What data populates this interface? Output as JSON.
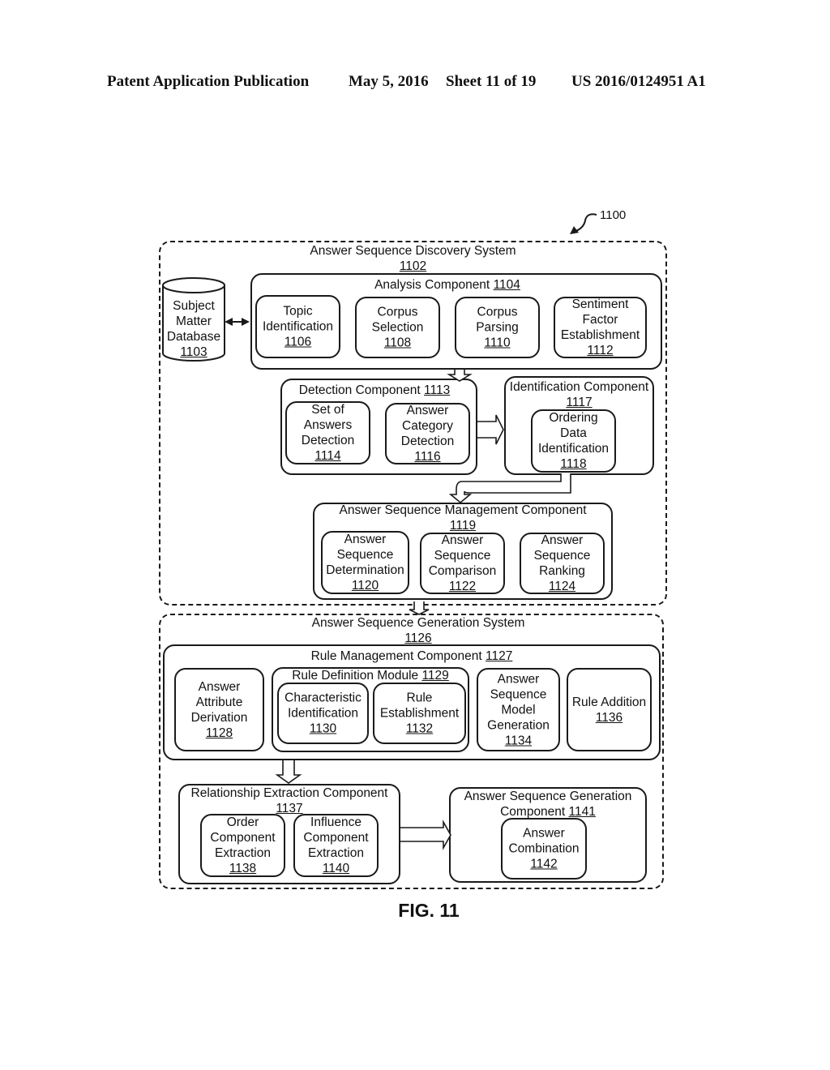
{
  "header": {
    "publication": "Patent Application Publication",
    "date": "May 5, 2016",
    "sheet": "Sheet 11 of 19",
    "patent_number": "US 2016/0124951 A1"
  },
  "figure": {
    "ref": "1100",
    "caption": "FIG. 11"
  },
  "discovery_system": {
    "title": "Answer Sequence Discovery System",
    "num": "1102",
    "database": {
      "lines": [
        "Subject",
        "Matter",
        "Database"
      ],
      "num": "1103"
    },
    "analysis": {
      "title": "Analysis Component",
      "num": "1104",
      "items": [
        {
          "lines": [
            "Topic",
            "Identification"
          ],
          "num": "1106"
        },
        {
          "lines": [
            "Corpus",
            "Selection"
          ],
          "num": "1108"
        },
        {
          "lines": [
            "Corpus",
            "Parsing"
          ],
          "num": "1110"
        },
        {
          "lines": [
            "Sentiment",
            "Factor",
            "Establishment"
          ],
          "num": "1112"
        }
      ]
    },
    "detection": {
      "title": "Detection Component",
      "num": "1113",
      "items": [
        {
          "lines": [
            "Set of",
            "Answers",
            "Detection"
          ],
          "num": "1114"
        },
        {
          "lines": [
            "Answer",
            "Category",
            "Detection"
          ],
          "num": "1116"
        }
      ]
    },
    "identification": {
      "title": "Identification Component",
      "num": "1117",
      "items": [
        {
          "lines": [
            "Ordering",
            "Data",
            "Identification"
          ],
          "num": "1118"
        }
      ]
    },
    "management": {
      "title": "Answer Sequence Management Component",
      "num": "1119",
      "items": [
        {
          "lines": [
            "Answer",
            "Sequence",
            "Determination"
          ],
          "num": "1120"
        },
        {
          "lines": [
            "Answer",
            "Sequence",
            "Comparison"
          ],
          "num": "1122"
        },
        {
          "lines": [
            "Answer",
            "Sequence",
            "Ranking"
          ],
          "num": "1124"
        }
      ]
    }
  },
  "generation_system": {
    "title": "Answer Sequence Generation System",
    "num": "1126",
    "rule_management": {
      "title": "Rule Management Component",
      "num": "1127",
      "attribute": {
        "lines": [
          "Answer",
          "Attribute",
          "Derivation"
        ],
        "num": "1128"
      },
      "rule_definition": {
        "title": "Rule Definition Module",
        "num": "1129",
        "items": [
          {
            "lines": [
              "Characteristic",
              "Identification"
            ],
            "num": "1130"
          },
          {
            "lines": [
              "Rule",
              "Establishment"
            ],
            "num": "1132"
          }
        ]
      },
      "model_generation": {
        "lines": [
          "Answer",
          "Sequence",
          "Model",
          "Generation"
        ],
        "num": "1134"
      },
      "rule_addition": {
        "lines": [
          "Rule Addition"
        ],
        "num": "1136"
      }
    },
    "relationship": {
      "title": "Relationship Extraction Component",
      "num": "1137",
      "items": [
        {
          "lines": [
            "Order",
            "Component",
            "Extraction"
          ],
          "num": "1138"
        },
        {
          "lines": [
            "Influence",
            "Component",
            "Extraction"
          ],
          "num": "1140"
        }
      ]
    },
    "generation_component": {
      "title_line1": "Answer Sequence Generation",
      "title_line2": "Component",
      "num": "1141",
      "items": [
        {
          "lines": [
            "Answer",
            "Combination"
          ],
          "num": "1142"
        }
      ]
    }
  }
}
